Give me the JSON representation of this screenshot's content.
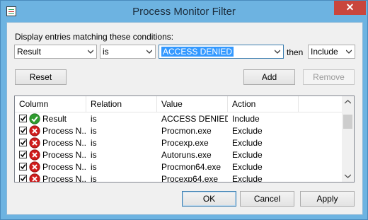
{
  "window": {
    "title": "Process Monitor Filter",
    "close_glyph": "✕"
  },
  "filter": {
    "display_label": "Display entries matching these conditions:",
    "column": "Result",
    "relation": "is",
    "value": "ACCESS DENIED",
    "then_label": "then",
    "action": "Include"
  },
  "buttons": {
    "reset": "Reset",
    "add": "Add",
    "remove": "Remove",
    "ok": "OK",
    "cancel": "Cancel",
    "apply": "Apply"
  },
  "table": {
    "headers": [
      "Column",
      "Relation",
      "Value",
      "Action"
    ],
    "rows": [
      {
        "column": "Result",
        "relation": "is",
        "value": "ACCESS DENIED",
        "action": "Include",
        "icon": "include-check-icon",
        "checked": true
      },
      {
        "column": "Process N...",
        "relation": "is",
        "value": "Procmon.exe",
        "action": "Exclude",
        "icon": "exclude-x-icon",
        "checked": true
      },
      {
        "column": "Process N...",
        "relation": "is",
        "value": "Procexp.exe",
        "action": "Exclude",
        "icon": "exclude-x-icon",
        "checked": true
      },
      {
        "column": "Process N...",
        "relation": "is",
        "value": "Autoruns.exe",
        "action": "Exclude",
        "icon": "exclude-x-icon",
        "checked": true
      },
      {
        "column": "Process N...",
        "relation": "is",
        "value": "Procmon64.exe",
        "action": "Exclude",
        "icon": "exclude-x-icon",
        "checked": true
      },
      {
        "column": "Process N...",
        "relation": "is",
        "value": "Procexp64.exe",
        "action": "Exclude",
        "icon": "exclude-x-icon",
        "checked": true
      }
    ]
  },
  "colors": {
    "titlebar": "#6db3e1",
    "close": "#c9463d",
    "selection": "#3399ff",
    "include": "#2e9c2e",
    "exclude": "#d01c1c"
  }
}
